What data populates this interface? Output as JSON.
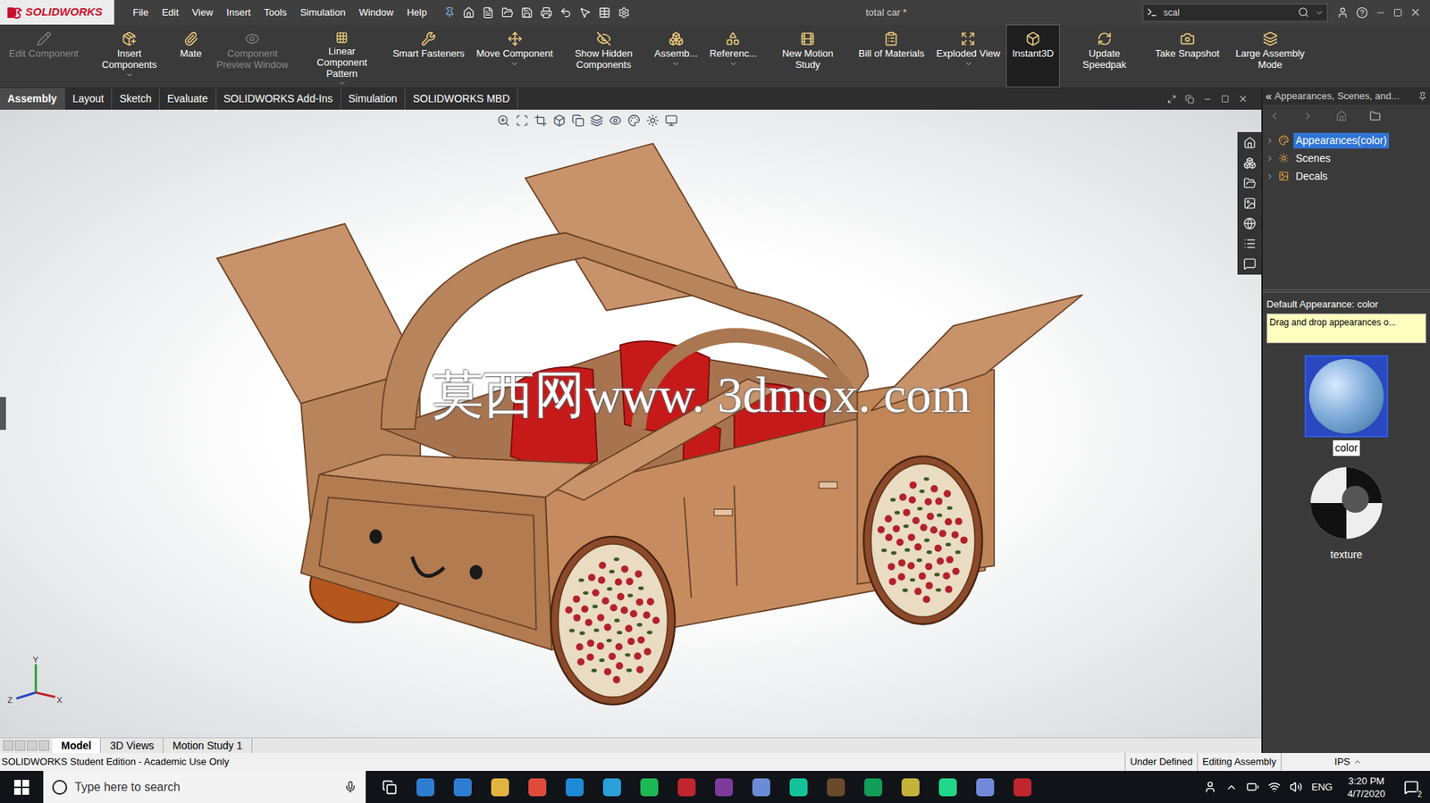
{
  "app": {
    "logo": "SOLIDWORKS"
  },
  "menu": [
    "File",
    "Edit",
    "View",
    "Insert",
    "Tools",
    "Simulation",
    "Window",
    "Help"
  ],
  "window": {
    "title": "total car *"
  },
  "search": {
    "value": "scal"
  },
  "command_manager": [
    {
      "label": "Edit Component",
      "disabled": true,
      "selected": false,
      "dropdown": false
    },
    {
      "label": "Insert Components",
      "disabled": false,
      "selected": false,
      "dropdown": true
    },
    {
      "label": "Mate",
      "disabled": false,
      "selected": false,
      "dropdown": false
    },
    {
      "label": "Component Preview Window",
      "disabled": true,
      "selected": false,
      "dropdown": false
    },
    {
      "label": "Linear Component Pattern",
      "disabled": false,
      "selected": false,
      "dropdown": true
    },
    {
      "label": "Smart Fasteners",
      "disabled": false,
      "selected": false,
      "dropdown": false
    },
    {
      "label": "Move Component",
      "disabled": false,
      "selected": false,
      "dropdown": true
    },
    {
      "label": "Show Hidden Components",
      "disabled": false,
      "selected": false,
      "dropdown": false
    },
    {
      "label": "Assemb...",
      "disabled": false,
      "selected": false,
      "dropdown": true
    },
    {
      "label": "Referenc...",
      "disabled": false,
      "selected": false,
      "dropdown": true
    },
    {
      "label": "New Motion Study",
      "disabled": false,
      "selected": false,
      "dropdown": false
    },
    {
      "label": "Bill of Materials",
      "disabled": false,
      "selected": false,
      "dropdown": false
    },
    {
      "label": "Exploded View",
      "disabled": false,
      "selected": false,
      "dropdown": true
    },
    {
      "label": "Instant3D",
      "disabled": false,
      "selected": true,
      "dropdown": false
    },
    {
      "label": "Update Speedpak",
      "disabled": false,
      "selected": false,
      "dropdown": false
    },
    {
      "label": "Take Snapshot",
      "disabled": false,
      "selected": false,
      "dropdown": false
    },
    {
      "label": "Large Assembly Mode",
      "disabled": false,
      "selected": false,
      "dropdown": false
    }
  ],
  "tabs": [
    {
      "label": "Assembly",
      "selected": true
    },
    {
      "label": "Layout",
      "selected": false
    },
    {
      "label": "Sketch",
      "selected": false
    },
    {
      "label": "Evaluate",
      "selected": false
    },
    {
      "label": "SOLIDWORKS Add-Ins",
      "selected": false
    },
    {
      "label": "Simulation",
      "selected": false
    },
    {
      "label": "SOLIDWORKS MBD",
      "selected": false
    }
  ],
  "graphics": {
    "watermark": "莫西网www. 3dmox. com",
    "triad": [
      "Y",
      "Z",
      "X"
    ]
  },
  "task_pane": {
    "collapse": "«",
    "title": "Appearances, Scenes, and...",
    "tree": [
      {
        "label": "Appearances(color)",
        "selected": true
      },
      {
        "label": "Scenes",
        "selected": false
      },
      {
        "label": "Decals",
        "selected": false
      }
    ],
    "default_label": "Default Appearance: color",
    "hint": "Drag and drop appearances o...",
    "thumbnails": [
      {
        "label": "color",
        "selected": true
      },
      {
        "label": "texture",
        "selected": false
      }
    ]
  },
  "bottom_tabs": [
    {
      "label": "Model",
      "selected": true
    },
    {
      "label": "3D Views",
      "selected": false
    },
    {
      "label": "Motion Study 1",
      "selected": false
    }
  ],
  "status_bar": {
    "edition": "SOLIDWORKS Student Edition - Academic Use Only",
    "items": [
      "Under Defined",
      "Editing Assembly",
      "IPS"
    ]
  },
  "taskbar": {
    "search_placeholder": "Type here to search",
    "language": "ENG",
    "time": "3:20 PM",
    "date": "4/7/2020",
    "notifications": "2"
  }
}
